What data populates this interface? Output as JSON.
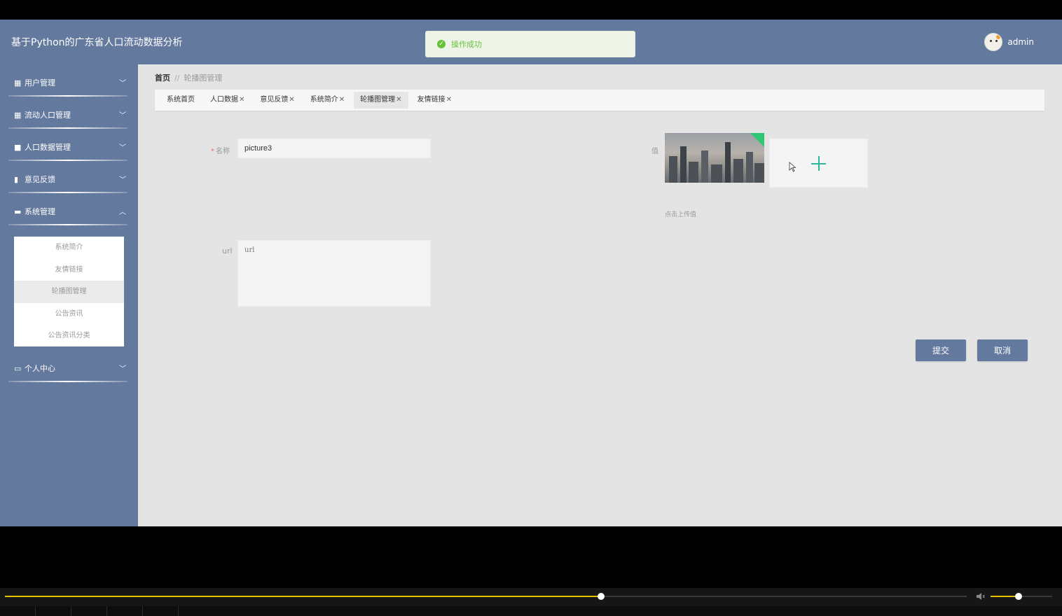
{
  "header": {
    "title": "基于Python的广东省人口流动数据分析",
    "username": "admin"
  },
  "toast": {
    "message": "操作成功",
    "color": "#67c23a"
  },
  "sidebar": {
    "items": [
      {
        "label": "用户管理",
        "icon": "grid-icon",
        "expanded": false
      },
      {
        "label": "流动人口管理",
        "icon": "grid-icon",
        "expanded": false
      },
      {
        "label": "人口数据管理",
        "icon": "briefcase-icon",
        "expanded": false
      },
      {
        "label": "意见反馈",
        "icon": "clipboard-icon",
        "expanded": false
      },
      {
        "label": "系统管理",
        "icon": "monitor-icon",
        "expanded": true
      },
      {
        "label": "个人中心",
        "icon": "card-icon",
        "expanded": false
      }
    ],
    "submenu": [
      "系统简介",
      "友情链接",
      "轮播图管理",
      "公告资讯",
      "公告资讯分类"
    ],
    "submenu_active": "轮播图管理"
  },
  "breadcrumb": {
    "home": "首页",
    "separator": "//",
    "current": "轮播图管理"
  },
  "tabs": [
    {
      "label": "系统首页",
      "closable": false,
      "active": false
    },
    {
      "label": "人口数据",
      "closable": true,
      "active": false
    },
    {
      "label": "意见反馈",
      "closable": true,
      "active": false
    },
    {
      "label": "系统简介",
      "closable": true,
      "active": false
    },
    {
      "label": "轮播图管理",
      "closable": true,
      "active": true
    },
    {
      "label": "友情链接",
      "closable": true,
      "active": false
    }
  ],
  "form": {
    "name_label": "名称",
    "name_required_mark": "*",
    "name_value": "picture3",
    "value_label": "值",
    "upload_hint": "点击上传值",
    "url_label": "url",
    "url_placeholder": "url",
    "submit_label": "提交",
    "cancel_label": "取消"
  },
  "player": {
    "progress": 0.62,
    "volume": 0.45,
    "accent": "#e8c200"
  },
  "theme": {
    "primary": "#64799e",
    "upload_plus": "#2fb49b"
  }
}
